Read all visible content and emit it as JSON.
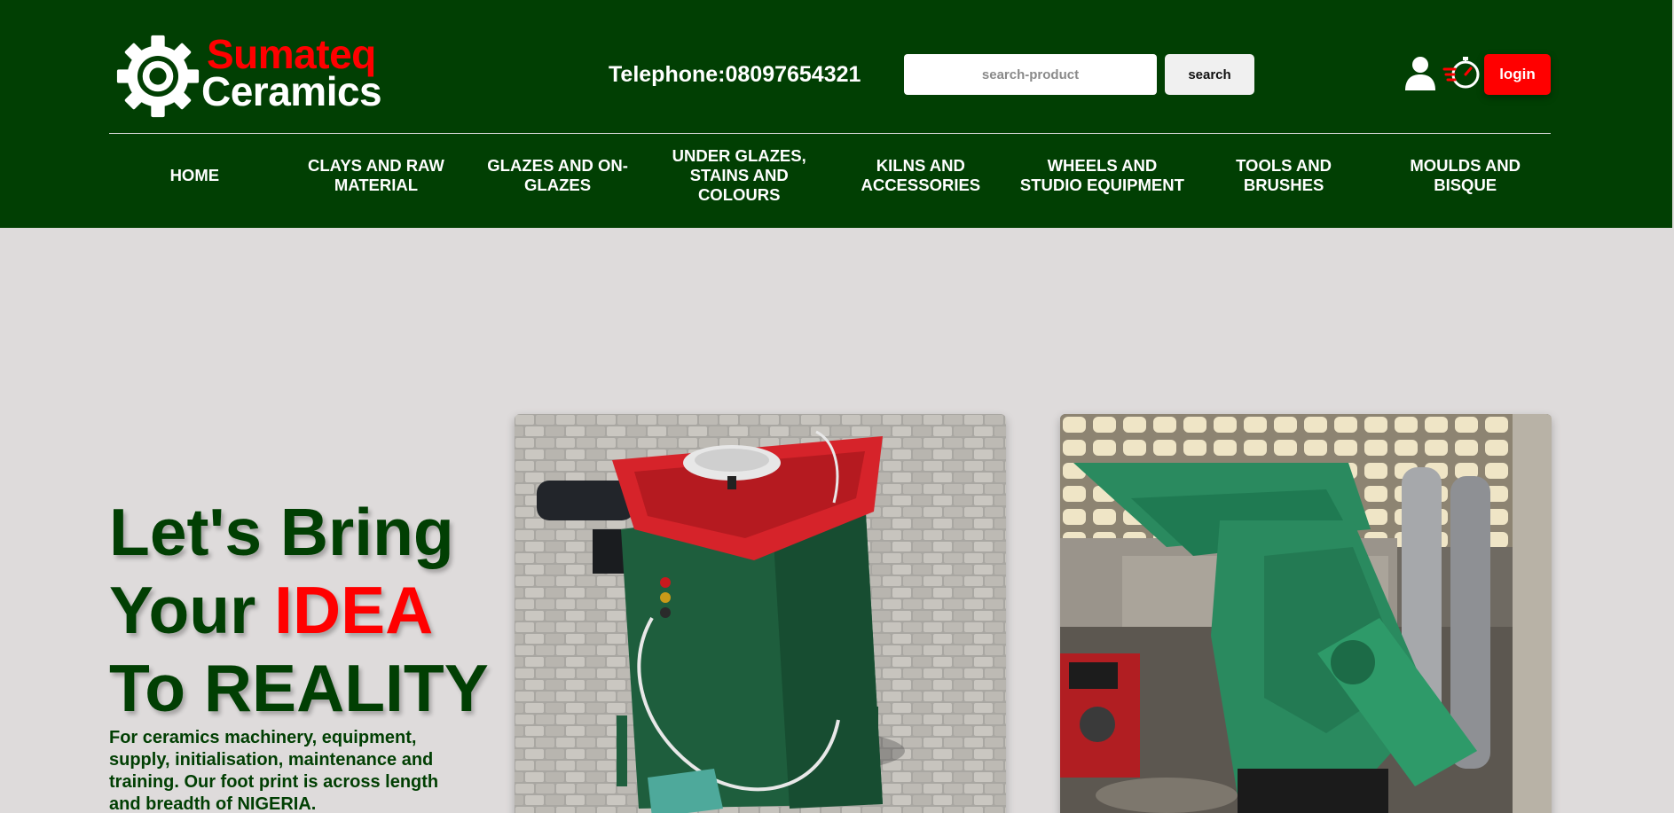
{
  "brand": {
    "name_line1": "Sumateq",
    "name_line2": "Ceramics",
    "icon": "gear-icon"
  },
  "header": {
    "phone": "Telephone:08097654321",
    "search": {
      "placeholder": "search-product",
      "button_label": "search"
    },
    "icons": [
      "user-icon",
      "stopwatch-icon"
    ],
    "login_label": "login"
  },
  "nav": {
    "items": [
      {
        "label": "HOME"
      },
      {
        "label": "CLAYS AND RAW MATERIAL"
      },
      {
        "label": "GLAZES AND ON-GLAZES"
      },
      {
        "label": "UNDER GLAZES, STAINS AND COLOURS"
      },
      {
        "label": "KILNS AND ACCESSORIES"
      },
      {
        "label": "WHEELS AND STUDIO EQUIPMENT"
      },
      {
        "label": "TOOLS AND BRUSHES"
      },
      {
        "label": "MOULDS AND BISQUE"
      }
    ]
  },
  "hero": {
    "title_line1": "Let's Bring",
    "title_line2_prefix": "Your ",
    "title_line2_accent": "IDEA",
    "title_line3": "To REALITY",
    "description": "For ceramics machinery, equipment, supply, initialisation, maintenance and training. Our foot print is across length and breadth of NIGERIA."
  },
  "colors": {
    "header_bg": "#013f03",
    "accent": "#ff0000",
    "page_bg": "#dedbdb",
    "text_dark_green": "#013f03"
  }
}
